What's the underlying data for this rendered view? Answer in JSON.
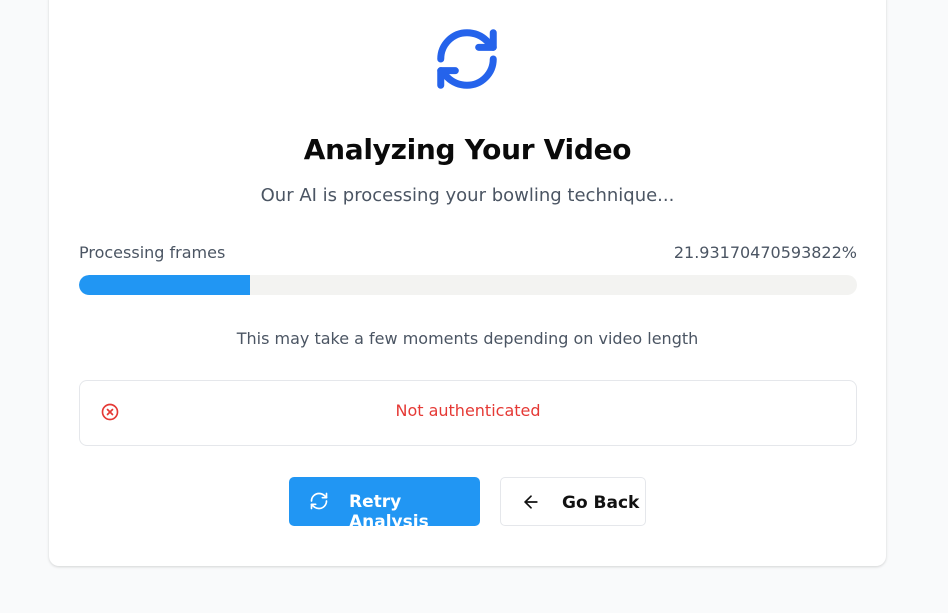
{
  "colors": {
    "accent": "#2196f3",
    "spinner": "#2563eb",
    "error": "#e53935",
    "muted_text": "#4b5563",
    "title_text": "#0a0a0a"
  },
  "header": {
    "icon": "refresh-icon",
    "title": "Analyzing Your Video",
    "subtitle": "Our AI is processing your bowling technique..."
  },
  "progress": {
    "label": "Processing frames",
    "value_text": "21.93170470593822%",
    "percent": 21.93170470593822
  },
  "hint": "This may take a few moments depending on video length",
  "error": {
    "icon": "x-circle-icon",
    "message": "Not authenticated"
  },
  "actions": {
    "retry": {
      "label": "Retry Analysis",
      "icon": "refresh-icon"
    },
    "back": {
      "label": "Go Back",
      "icon": "arrow-left-icon"
    }
  }
}
